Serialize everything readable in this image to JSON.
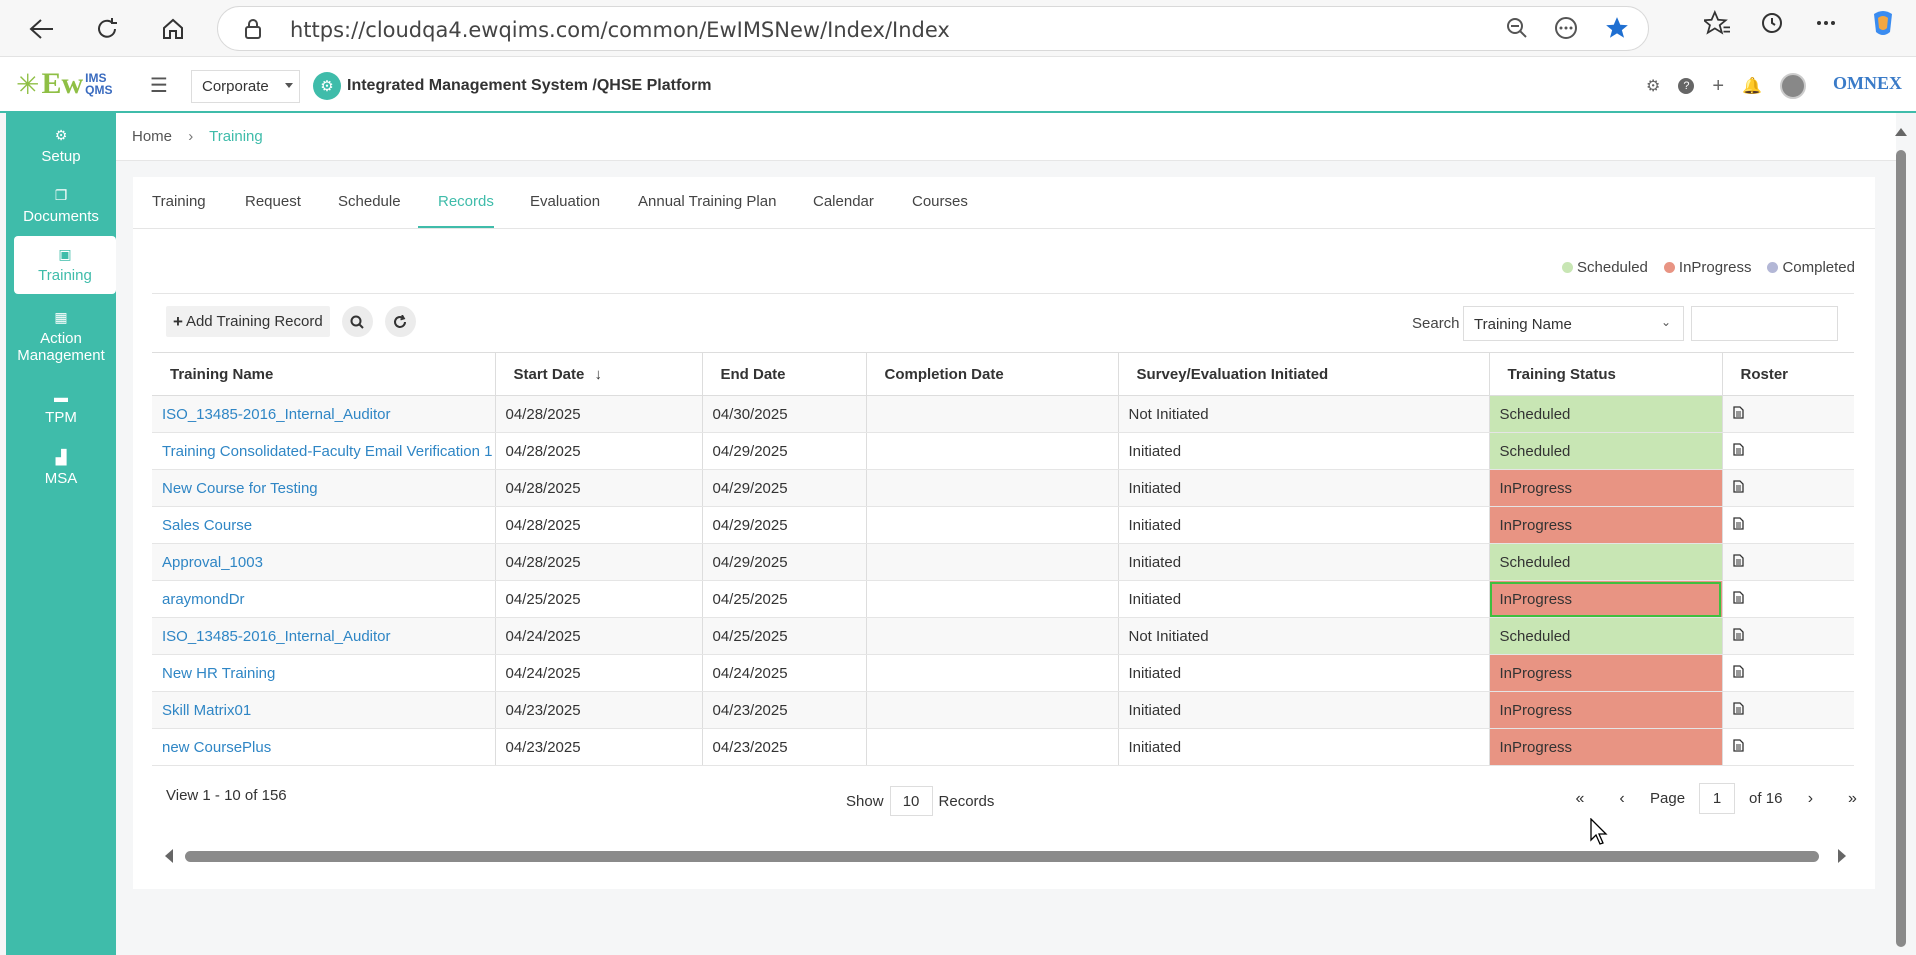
{
  "browser": {
    "url": "https://cloudqa4.ewqims.com/common/EwIMSNew/Index/Index"
  },
  "header": {
    "logo_main": "Ew",
    "logo_ims": "IMS",
    "logo_qms": "QMS",
    "org": "Corporate",
    "platform_title": "Integrated Management System /QHSE Platform",
    "brand_right": "OMNEX"
  },
  "sidebar": {
    "items": [
      {
        "label": "Setup"
      },
      {
        "label": "Documents"
      },
      {
        "label": "Training"
      },
      {
        "label": "Action Management"
      },
      {
        "label": "TPM"
      },
      {
        "label": "MSA"
      }
    ]
  },
  "breadcrumb": {
    "home": "Home",
    "current": "Training"
  },
  "tabs": [
    {
      "label": "Training"
    },
    {
      "label": "Request"
    },
    {
      "label": "Schedule"
    },
    {
      "label": "Records"
    },
    {
      "label": "Evaluation"
    },
    {
      "label": "Annual Training Plan"
    },
    {
      "label": "Calendar"
    },
    {
      "label": "Courses"
    }
  ],
  "legend": [
    {
      "label": "Scheduled",
      "color": "#c8e6b4"
    },
    {
      "label": "InProgress",
      "color": "#e89483"
    },
    {
      "label": "Completed",
      "color": "#b3b7d6"
    }
  ],
  "toolbar": {
    "add_label": "Add Training Record",
    "search_label": "Search",
    "search_field": "Training Name"
  },
  "table": {
    "columns": [
      "Training Name",
      "Start Date",
      "End Date",
      "Completion Date",
      "Survey/Evaluation Initiated",
      "Training Status",
      "Roster"
    ],
    "rows": [
      {
        "name": "ISO_13485-2016_Internal_Auditor",
        "start": "04/28/2025",
        "end": "04/30/2025",
        "completion": "",
        "survey": "Not Initiated",
        "status": "Scheduled"
      },
      {
        "name": "Training Consolidated-Faculty Email Verification 1",
        "start": "04/28/2025",
        "end": "04/29/2025",
        "completion": "",
        "survey": "Initiated",
        "status": "Scheduled"
      },
      {
        "name": "New Course for Testing",
        "start": "04/28/2025",
        "end": "04/29/2025",
        "completion": "",
        "survey": "Initiated",
        "status": "InProgress"
      },
      {
        "name": "Sales Course",
        "start": "04/28/2025",
        "end": "04/29/2025",
        "completion": "",
        "survey": "Initiated",
        "status": "InProgress"
      },
      {
        "name": "Approval_1003",
        "start": "04/28/2025",
        "end": "04/29/2025",
        "completion": "",
        "survey": "Initiated",
        "status": "Scheduled"
      },
      {
        "name": "araymondDr",
        "start": "04/25/2025",
        "end": "04/25/2025",
        "completion": "",
        "survey": "Initiated",
        "status": "InProgress"
      },
      {
        "name": "ISO_13485-2016_Internal_Auditor",
        "start": "04/24/2025",
        "end": "04/25/2025",
        "completion": "",
        "survey": "Not Initiated",
        "status": "Scheduled"
      },
      {
        "name": "New HR Training",
        "start": "04/24/2025",
        "end": "04/24/2025",
        "completion": "",
        "survey": "Initiated",
        "status": "InProgress"
      },
      {
        "name": "Skill Matrix01",
        "start": "04/23/2025",
        "end": "04/23/2025",
        "completion": "",
        "survey": "Initiated",
        "status": "InProgress"
      },
      {
        "name": "new CoursePlus",
        "start": "04/23/2025",
        "end": "04/23/2025",
        "completion": "",
        "survey": "Initiated",
        "status": "InProgress"
      }
    ]
  },
  "footer": {
    "view_text": "View 1 - 10 of 156",
    "show_label": "Show",
    "page_size": "10",
    "records_label": "Records",
    "page_label": "Page",
    "page": "1",
    "of_label": "of 16"
  }
}
